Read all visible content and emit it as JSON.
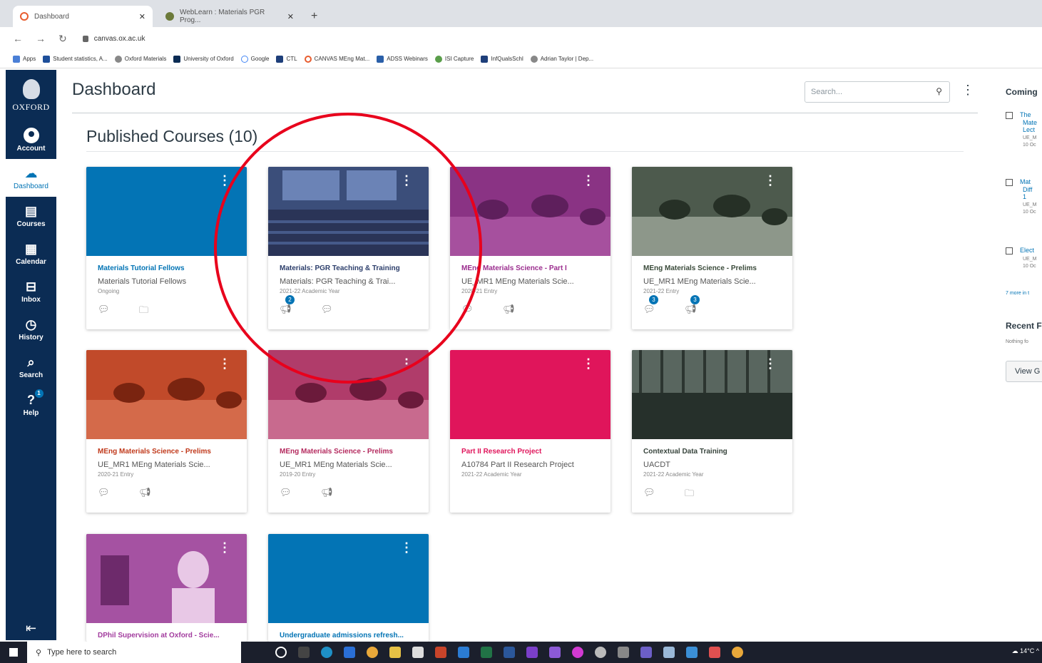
{
  "browser": {
    "tabs": [
      {
        "label": "Dashboard",
        "active": true
      },
      {
        "label": "WebLearn : Materials PGR Prog...",
        "active": false
      }
    ],
    "url": "canvas.ox.ac.uk",
    "bookmarks": [
      "Apps",
      "Student statistics, A...",
      "Oxford Materials",
      "University of Oxford",
      "Google",
      "CTL",
      "CANVAS MEng Mat...",
      "ADSS Webinars",
      "ISI Capture",
      "InfQualsSchl",
      "Adrian Taylor | Dep..."
    ]
  },
  "nav": {
    "logo_text": "OXFORD",
    "items": [
      {
        "label": "Account",
        "icon": "account-icon"
      },
      {
        "label": "Dashboard",
        "icon": "dashboard-icon",
        "active": true
      },
      {
        "label": "Courses",
        "icon": "courses-icon"
      },
      {
        "label": "Calendar",
        "icon": "calendar-icon"
      },
      {
        "label": "Inbox",
        "icon": "inbox-icon"
      },
      {
        "label": "History",
        "icon": "history-icon"
      },
      {
        "label": "Search",
        "icon": "search-icon"
      },
      {
        "label": "Help",
        "icon": "help-icon",
        "badge": "1"
      }
    ]
  },
  "header": {
    "title": "Dashboard",
    "search_placeholder": "Search..."
  },
  "section_title": "Published Courses (10)",
  "courses": [
    {
      "title": "Materials Tutorial Fellows",
      "subtitle": "Materials Tutorial Fellows",
      "term": "Ongoing",
      "color": "#0374b5",
      "badges": [
        "",
        ""
      ]
    },
    {
      "title": "Materials: PGR Teaching & Training",
      "subtitle": "Materials: PGR Teaching & Trai...",
      "term": "2021-22 Academic Year",
      "color": "#2c3e6b",
      "badges": [
        "2",
        ""
      ]
    },
    {
      "title": "MEng Materials Science - Part I",
      "subtitle": "UE_MR1 MEng Materials Scie...",
      "term": "2020-21 Entry",
      "color": "#9b2d8e",
      "badges": [
        "",
        ""
      ]
    },
    {
      "title": "MEng Materials Science - Prelims",
      "subtitle": "UE_MR1 MEng Materials Scie...",
      "term": "2021-22 Entry",
      "color": "#3a4a3a",
      "badges": [
        "3",
        "3"
      ]
    },
    {
      "title": "MEng Materials Science - Prelims",
      "subtitle": "UE_MR1 MEng Materials Scie...",
      "term": "2020-21 Entry",
      "color": "#c0391b",
      "badges": [
        "",
        ""
      ]
    },
    {
      "title": "MEng Materials Science - Prelims",
      "subtitle": "UE_MR1 MEng Materials Scie...",
      "term": "2019-20 Entry",
      "color": "#b42a5e",
      "badges": [
        "",
        ""
      ]
    },
    {
      "title": "Part II Research Project",
      "subtitle": "A10784 Part II Research Project",
      "term": "2021-22 Academic Year",
      "color": "#e0155b",
      "badges": []
    },
    {
      "title": "Contextual Data Training",
      "subtitle": "UACDT",
      "term": "2021-22 Academic Year",
      "color": "#37443c",
      "badges": [
        "",
        ""
      ]
    },
    {
      "title": "DPhil Supervision at Oxford - Scie...",
      "subtitle": "",
      "term": "",
      "color": "#a23c9e",
      "badges": []
    },
    {
      "title": "Undergraduate admissions refresh...",
      "subtitle": "",
      "term": "",
      "color": "#0374b5",
      "badges": []
    }
  ],
  "right_sidebar": {
    "coming_up": "Coming",
    "items": [
      {
        "line1": "The",
        "line2": "Mate",
        "line3": "Lect",
        "meta": "UE_M",
        "date": "10 Oc"
      },
      {
        "line1": "Mat",
        "line2": "Diff",
        "line3": "1",
        "meta": "UE_M",
        "date": "10 Oc"
      },
      {
        "line1": "Elect",
        "line2": "",
        "line3": "",
        "meta": "UE_M",
        "date": "10 Oc"
      }
    ],
    "more": "7 more in t",
    "recent": "Recent F",
    "nothing": "Nothing fo",
    "view": "View G"
  },
  "taskbar": {
    "search_placeholder": "Type here to search",
    "temp": "14°C"
  }
}
